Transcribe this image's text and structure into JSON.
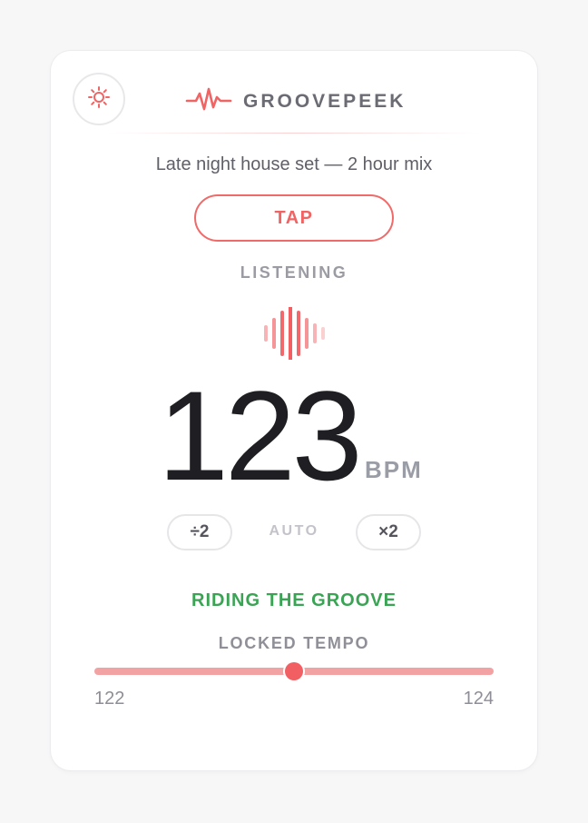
{
  "app": {
    "brand_name": "GROOVEPEEK",
    "logo_icon": "pulse-wave-icon",
    "theme_icon": "sun-icon",
    "accent_color": "#f06464"
  },
  "session": {
    "title": "Late night house set — 2 hour mix"
  },
  "controls": {
    "tap_label": "TAP",
    "status_label": "LISTENING",
    "half_label": "÷2",
    "mode_label": "AUTO",
    "double_label": "×2"
  },
  "tempo": {
    "bpm": "123",
    "unit": "BPM",
    "groove_status": "RIDING THE GROOVE",
    "groove_color": "#3aa354"
  },
  "range": {
    "label": "LOCKED TEMPO",
    "min": "122",
    "max": "124",
    "position_fraction": 0.5
  }
}
